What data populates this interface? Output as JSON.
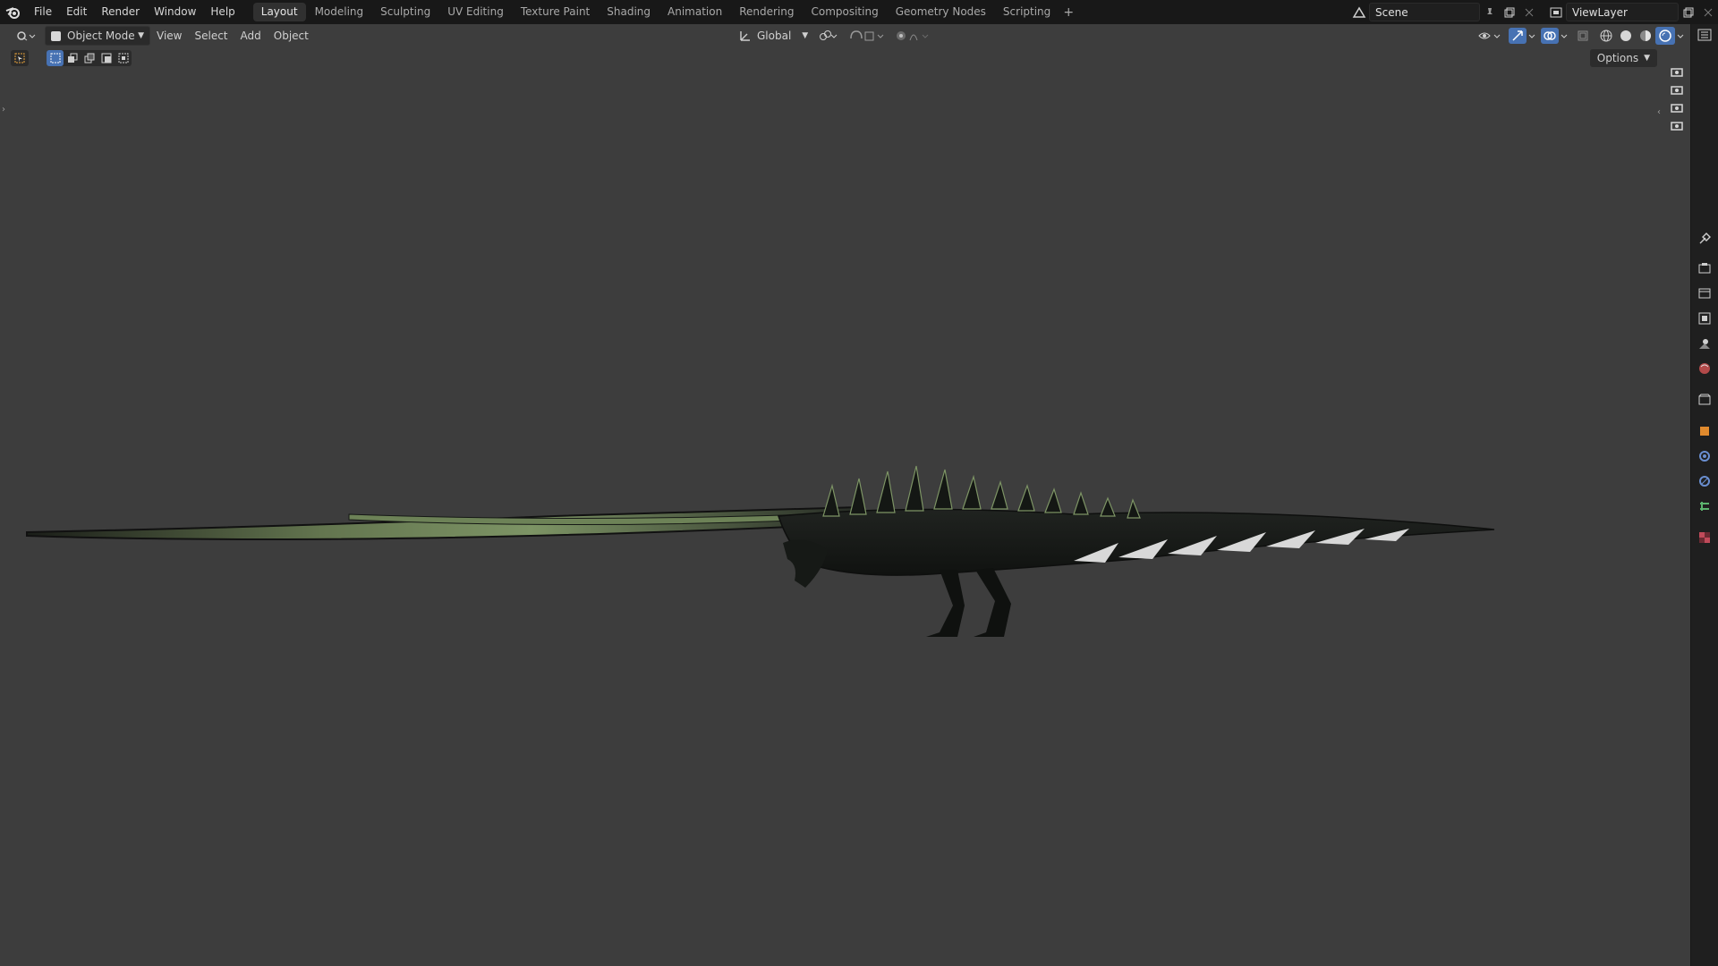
{
  "app": {
    "name": "Blender"
  },
  "menu": [
    "File",
    "Edit",
    "Render",
    "Window",
    "Help"
  ],
  "workspaces": {
    "active": "Layout",
    "tabs": [
      "Layout",
      "Modeling",
      "Sculpting",
      "UV Editing",
      "Texture Paint",
      "Shading",
      "Animation",
      "Rendering",
      "Compositing",
      "Geometry Nodes",
      "Scripting"
    ],
    "add_label": "+"
  },
  "scene": {
    "name": "Scene"
  },
  "view_layer": {
    "name": "ViewLayer"
  },
  "viewport_header": {
    "mode": "Object Mode",
    "menus": [
      "View",
      "Select",
      "Add",
      "Object"
    ],
    "transform_orientation": "Global",
    "options_label": "Options"
  },
  "colors": {
    "viewport_bg": "#3d3d3d",
    "topbar_bg": "#181818",
    "accent_active": "#4772b3",
    "dragon_dark": "#1c1f1a",
    "dragon_wing": "#7d9465"
  },
  "icons": {
    "logo": "blender-logo-icon",
    "editor_type": "3d-viewport-icon",
    "properties": [
      "tool-icon",
      "render-icon",
      "output-icon",
      "view-layer-icon",
      "scene-icon",
      "world-icon",
      "collection-icon",
      "object-icon",
      "modifier-icon",
      "particles-icon",
      "physics-icon",
      "constraint-icon",
      "data-icon",
      "texture-icon"
    ]
  }
}
